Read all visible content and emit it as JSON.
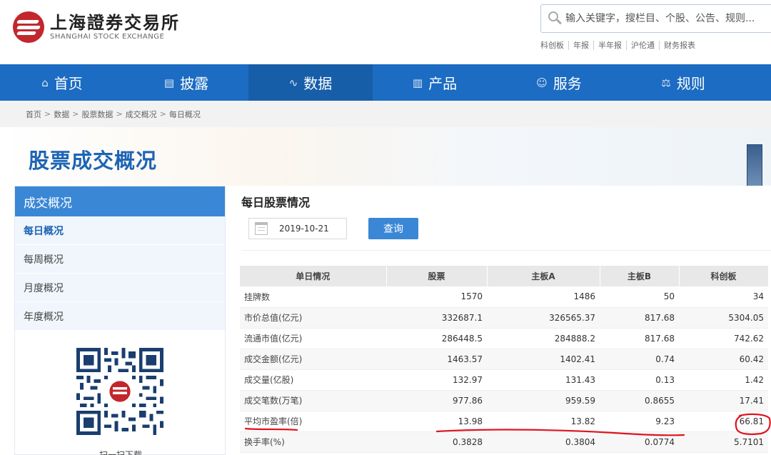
{
  "header": {
    "logo_cn": "上海證券交易所",
    "logo_en": "SHANGHAI STOCK EXCHANGE",
    "search_placeholder": "输入关键字，搜栏目、个股、公告、规则...",
    "quick_links": [
      "科创板",
      "年报",
      "半年报",
      "沪伦通",
      "财务报表"
    ]
  },
  "nav": [
    {
      "label": "首页",
      "icon": "home-icon",
      "glyph": "⌂"
    },
    {
      "label": "披露",
      "icon": "document-icon",
      "glyph": "▤"
    },
    {
      "label": "数据",
      "icon": "chart-line-icon",
      "glyph": "∿"
    },
    {
      "label": "产品",
      "icon": "bar-chart-icon",
      "glyph": "▥"
    },
    {
      "label": "服务",
      "icon": "user-icon",
      "glyph": "☺"
    },
    {
      "label": "规则",
      "icon": "scale-icon",
      "glyph": "⚖"
    }
  ],
  "breadcrumb": [
    "首页",
    "数据",
    "股票数据",
    "成交概况",
    "每日概况"
  ],
  "page_title": "股票成交概况",
  "sidebar": {
    "heading": "成交概况",
    "items": [
      "每日概况",
      "每周概况",
      "月度概况",
      "年度概况"
    ],
    "qr_caption": "扫一扫下载"
  },
  "main": {
    "title": "每日股票情况",
    "date": "2019-10-21",
    "query_label": "查询",
    "columns": [
      "单日情况",
      "股票",
      "主板A",
      "主板B",
      "科创板"
    ],
    "rows": [
      [
        "挂牌数",
        "1570",
        "1486",
        "50",
        "34"
      ],
      [
        "市价总值(亿元)",
        "332687.1",
        "326565.37",
        "817.68",
        "5304.05"
      ],
      [
        "流通市值(亿元)",
        "286448.5",
        "284888.2",
        "817.68",
        "742.62"
      ],
      [
        "成交金额(亿元)",
        "1463.57",
        "1402.41",
        "0.74",
        "60.42"
      ],
      [
        "成交量(亿股)",
        "132.97",
        "131.43",
        "0.13",
        "1.42"
      ],
      [
        "成交笔数(万笔)",
        "977.86",
        "959.59",
        "0.8655",
        "17.41"
      ],
      [
        "平均市盈率(倍)",
        "13.98",
        "13.82",
        "9.23",
        "66.81"
      ],
      [
        "换手率(%)",
        "0.3828",
        "0.3804",
        "0.0774",
        "5.7101"
      ]
    ]
  },
  "colors": {
    "brand_blue": "#1b6cc2",
    "accent_blue": "#3a87d6",
    "title_blue": "#1d64b5",
    "logo_red": "#c1272d",
    "annotation_red": "#e0141e"
  }
}
